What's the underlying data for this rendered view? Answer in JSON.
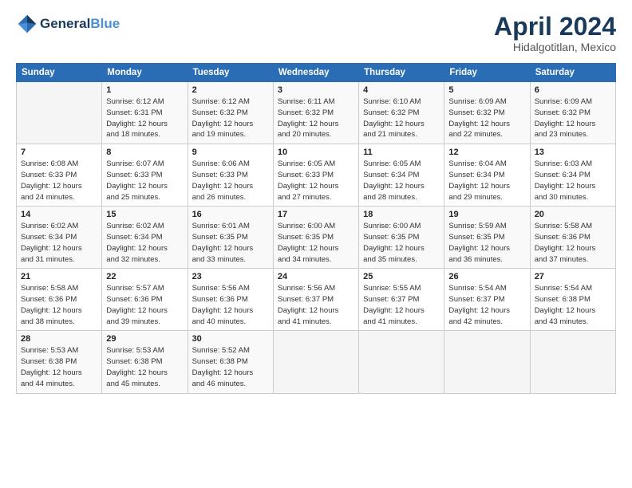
{
  "header": {
    "logo_line1": "General",
    "logo_line2": "Blue",
    "month_title": "April 2024",
    "location": "Hidalgotitlan, Mexico"
  },
  "weekdays": [
    "Sunday",
    "Monday",
    "Tuesday",
    "Wednesday",
    "Thursday",
    "Friday",
    "Saturday"
  ],
  "weeks": [
    [
      {
        "day": "",
        "sunrise": "",
        "sunset": "",
        "daylight": ""
      },
      {
        "day": "1",
        "sunrise": "Sunrise: 6:12 AM",
        "sunset": "Sunset: 6:31 PM",
        "daylight": "Daylight: 12 hours and 18 minutes."
      },
      {
        "day": "2",
        "sunrise": "Sunrise: 6:12 AM",
        "sunset": "Sunset: 6:32 PM",
        "daylight": "Daylight: 12 hours and 19 minutes."
      },
      {
        "day": "3",
        "sunrise": "Sunrise: 6:11 AM",
        "sunset": "Sunset: 6:32 PM",
        "daylight": "Daylight: 12 hours and 20 minutes."
      },
      {
        "day": "4",
        "sunrise": "Sunrise: 6:10 AM",
        "sunset": "Sunset: 6:32 PM",
        "daylight": "Daylight: 12 hours and 21 minutes."
      },
      {
        "day": "5",
        "sunrise": "Sunrise: 6:09 AM",
        "sunset": "Sunset: 6:32 PM",
        "daylight": "Daylight: 12 hours and 22 minutes."
      },
      {
        "day": "6",
        "sunrise": "Sunrise: 6:09 AM",
        "sunset": "Sunset: 6:32 PM",
        "daylight": "Daylight: 12 hours and 23 minutes."
      }
    ],
    [
      {
        "day": "7",
        "sunrise": "Sunrise: 6:08 AM",
        "sunset": "Sunset: 6:33 PM",
        "daylight": "Daylight: 12 hours and 24 minutes."
      },
      {
        "day": "8",
        "sunrise": "Sunrise: 6:07 AM",
        "sunset": "Sunset: 6:33 PM",
        "daylight": "Daylight: 12 hours and 25 minutes."
      },
      {
        "day": "9",
        "sunrise": "Sunrise: 6:06 AM",
        "sunset": "Sunset: 6:33 PM",
        "daylight": "Daylight: 12 hours and 26 minutes."
      },
      {
        "day": "10",
        "sunrise": "Sunrise: 6:05 AM",
        "sunset": "Sunset: 6:33 PM",
        "daylight": "Daylight: 12 hours and 27 minutes."
      },
      {
        "day": "11",
        "sunrise": "Sunrise: 6:05 AM",
        "sunset": "Sunset: 6:34 PM",
        "daylight": "Daylight: 12 hours and 28 minutes."
      },
      {
        "day": "12",
        "sunrise": "Sunrise: 6:04 AM",
        "sunset": "Sunset: 6:34 PM",
        "daylight": "Daylight: 12 hours and 29 minutes."
      },
      {
        "day": "13",
        "sunrise": "Sunrise: 6:03 AM",
        "sunset": "Sunset: 6:34 PM",
        "daylight": "Daylight: 12 hours and 30 minutes."
      }
    ],
    [
      {
        "day": "14",
        "sunrise": "Sunrise: 6:02 AM",
        "sunset": "Sunset: 6:34 PM",
        "daylight": "Daylight: 12 hours and 31 minutes."
      },
      {
        "day": "15",
        "sunrise": "Sunrise: 6:02 AM",
        "sunset": "Sunset: 6:34 PM",
        "daylight": "Daylight: 12 hours and 32 minutes."
      },
      {
        "day": "16",
        "sunrise": "Sunrise: 6:01 AM",
        "sunset": "Sunset: 6:35 PM",
        "daylight": "Daylight: 12 hours and 33 minutes."
      },
      {
        "day": "17",
        "sunrise": "Sunrise: 6:00 AM",
        "sunset": "Sunset: 6:35 PM",
        "daylight": "Daylight: 12 hours and 34 minutes."
      },
      {
        "day": "18",
        "sunrise": "Sunrise: 6:00 AM",
        "sunset": "Sunset: 6:35 PM",
        "daylight": "Daylight: 12 hours and 35 minutes."
      },
      {
        "day": "19",
        "sunrise": "Sunrise: 5:59 AM",
        "sunset": "Sunset: 6:35 PM",
        "daylight": "Daylight: 12 hours and 36 minutes."
      },
      {
        "day": "20",
        "sunrise": "Sunrise: 5:58 AM",
        "sunset": "Sunset: 6:36 PM",
        "daylight": "Daylight: 12 hours and 37 minutes."
      }
    ],
    [
      {
        "day": "21",
        "sunrise": "Sunrise: 5:58 AM",
        "sunset": "Sunset: 6:36 PM",
        "daylight": "Daylight: 12 hours and 38 minutes."
      },
      {
        "day": "22",
        "sunrise": "Sunrise: 5:57 AM",
        "sunset": "Sunset: 6:36 PM",
        "daylight": "Daylight: 12 hours and 39 minutes."
      },
      {
        "day": "23",
        "sunrise": "Sunrise: 5:56 AM",
        "sunset": "Sunset: 6:36 PM",
        "daylight": "Daylight: 12 hours and 40 minutes."
      },
      {
        "day": "24",
        "sunrise": "Sunrise: 5:56 AM",
        "sunset": "Sunset: 6:37 PM",
        "daylight": "Daylight: 12 hours and 41 minutes."
      },
      {
        "day": "25",
        "sunrise": "Sunrise: 5:55 AM",
        "sunset": "Sunset: 6:37 PM",
        "daylight": "Daylight: 12 hours and 41 minutes."
      },
      {
        "day": "26",
        "sunrise": "Sunrise: 5:54 AM",
        "sunset": "Sunset: 6:37 PM",
        "daylight": "Daylight: 12 hours and 42 minutes."
      },
      {
        "day": "27",
        "sunrise": "Sunrise: 5:54 AM",
        "sunset": "Sunset: 6:38 PM",
        "daylight": "Daylight: 12 hours and 43 minutes."
      }
    ],
    [
      {
        "day": "28",
        "sunrise": "Sunrise: 5:53 AM",
        "sunset": "Sunset: 6:38 PM",
        "daylight": "Daylight: 12 hours and 44 minutes."
      },
      {
        "day": "29",
        "sunrise": "Sunrise: 5:53 AM",
        "sunset": "Sunset: 6:38 PM",
        "daylight": "Daylight: 12 hours and 45 minutes."
      },
      {
        "day": "30",
        "sunrise": "Sunrise: 5:52 AM",
        "sunset": "Sunset: 6:38 PM",
        "daylight": "Daylight: 12 hours and 46 minutes."
      },
      {
        "day": "",
        "sunrise": "",
        "sunset": "",
        "daylight": ""
      },
      {
        "day": "",
        "sunrise": "",
        "sunset": "",
        "daylight": ""
      },
      {
        "day": "",
        "sunrise": "",
        "sunset": "",
        "daylight": ""
      },
      {
        "day": "",
        "sunrise": "",
        "sunset": "",
        "daylight": ""
      }
    ]
  ]
}
